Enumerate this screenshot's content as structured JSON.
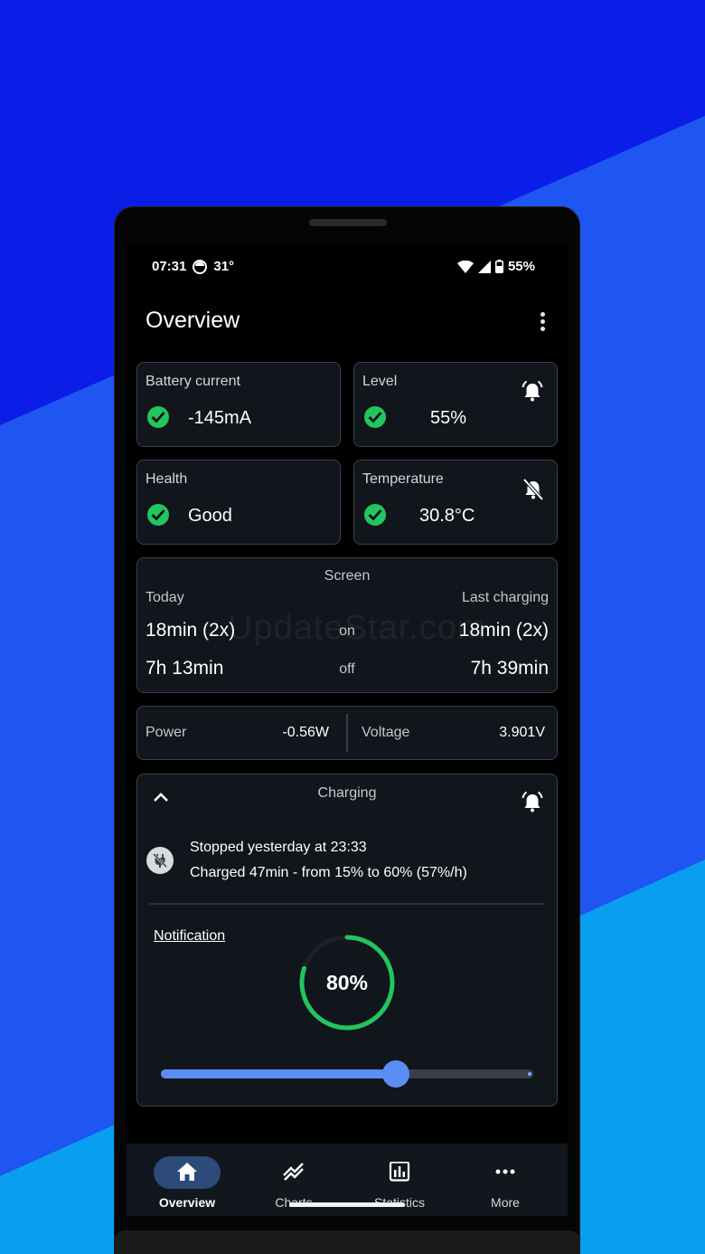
{
  "colors": {
    "accent": "#5b8ef5",
    "ok": "#22c55e",
    "card_bg": "#11151c",
    "card_border": "#3b4048"
  },
  "status_bar": {
    "time": "07:31",
    "weather": "31°",
    "battery": "55%"
  },
  "appbar": {
    "title": "Overview"
  },
  "cards": {
    "battery_current": {
      "label": "Battery current",
      "value": "-145mA"
    },
    "level": {
      "label": "Level",
      "value": "55%"
    },
    "health": {
      "label": "Health",
      "value": "Good"
    },
    "temperature": {
      "label": "Temperature",
      "value": "30.8°C"
    }
  },
  "screen_card": {
    "title": "Screen",
    "today_label": "Today",
    "last_label": "Last charging",
    "on_label": "on",
    "off_label": "off",
    "today_on": "18min (2x)",
    "today_off": "7h 13min",
    "last_on": "18min (2x)",
    "last_off": "7h 39min",
    "watermark": "UpdateStar.com"
  },
  "power_card": {
    "power_label": "Power",
    "power_value": "-0.56W",
    "voltage_label": "Voltage",
    "voltage_value": "3.901V"
  },
  "charging": {
    "title": "Charging",
    "line1": "Stopped yesterday at 23:33",
    "line2": "Charged 47min - from 15% to 60% (57%/h)",
    "notification_label": "Notification",
    "target_text": "80%",
    "target_fraction": 0.8,
    "slider_fraction": 0.63
  },
  "nav": [
    {
      "label": "Overview",
      "icon": "home-icon",
      "active": true
    },
    {
      "label": "Charts",
      "icon": "charts-icon",
      "active": false
    },
    {
      "label": "Statistics",
      "icon": "statistics-icon",
      "active": false
    },
    {
      "label": "More",
      "icon": "more-icon",
      "active": false
    }
  ]
}
